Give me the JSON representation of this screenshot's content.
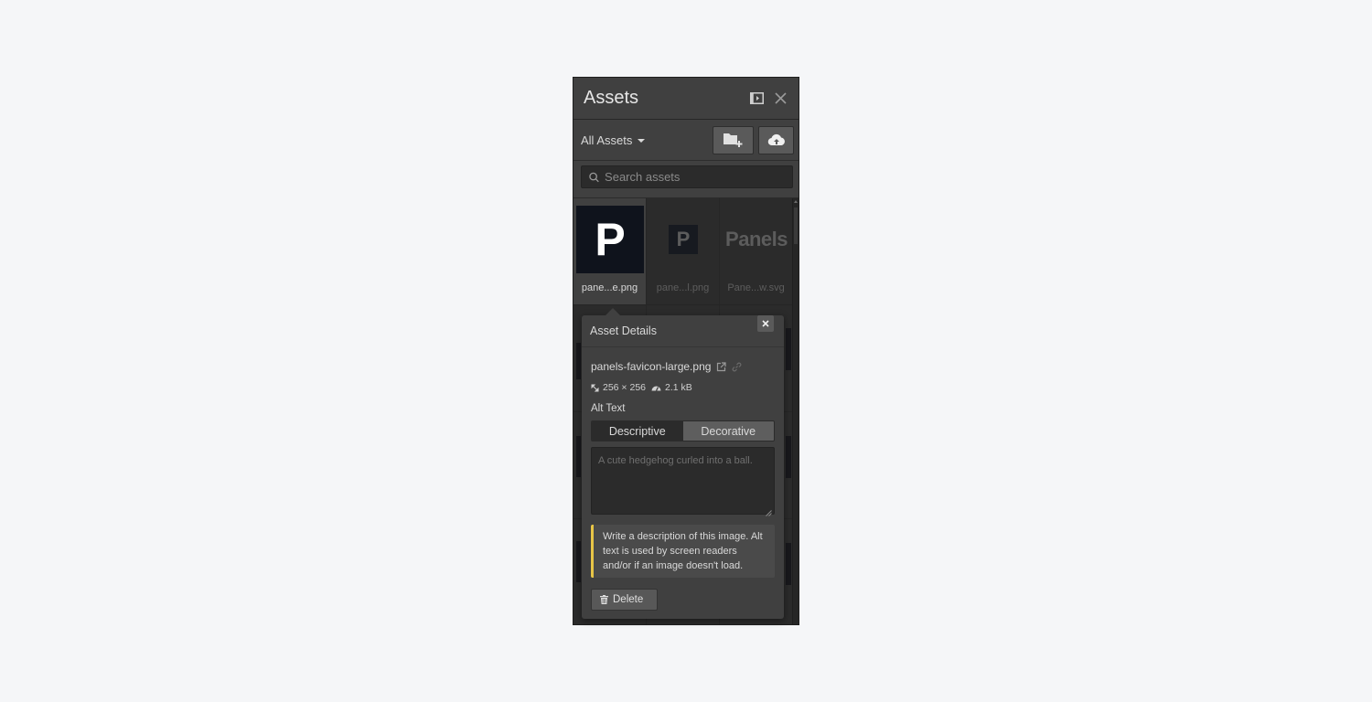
{
  "panel": {
    "title": "Assets",
    "dock_icon": "dock-panel-icon",
    "close_icon": "close-icon"
  },
  "toolbar": {
    "filter_label": "All Assets",
    "new_folder_icon": "folder-add-icon",
    "upload_icon": "cloud-upload-icon"
  },
  "search": {
    "placeholder": "Search assets",
    "value": ""
  },
  "assets": [
    {
      "name": "pane...e.png",
      "preview": "P",
      "selected": true
    },
    {
      "name": "pane...l.png",
      "preview": "P",
      "selected": false
    },
    {
      "name": "Pane...w.svg",
      "preview": "Panels",
      "selected": false
    }
  ],
  "details": {
    "title": "Asset Details",
    "filename": "panels-favicon-large.png",
    "dimensions": "256 × 256",
    "size": "2.1 kB",
    "alt_label": "Alt Text",
    "alt_options": [
      "Descriptive",
      "Decorative"
    ],
    "alt_selected": "Decorative",
    "alt_placeholder": "A cute hedgehog curled into a ball.",
    "alt_value": "",
    "hint": "Write a description of this image. Alt text is used by screen readers and/or if an image doesn't load.",
    "delete_label": "Delete",
    "accent_color": "#e8c547"
  }
}
